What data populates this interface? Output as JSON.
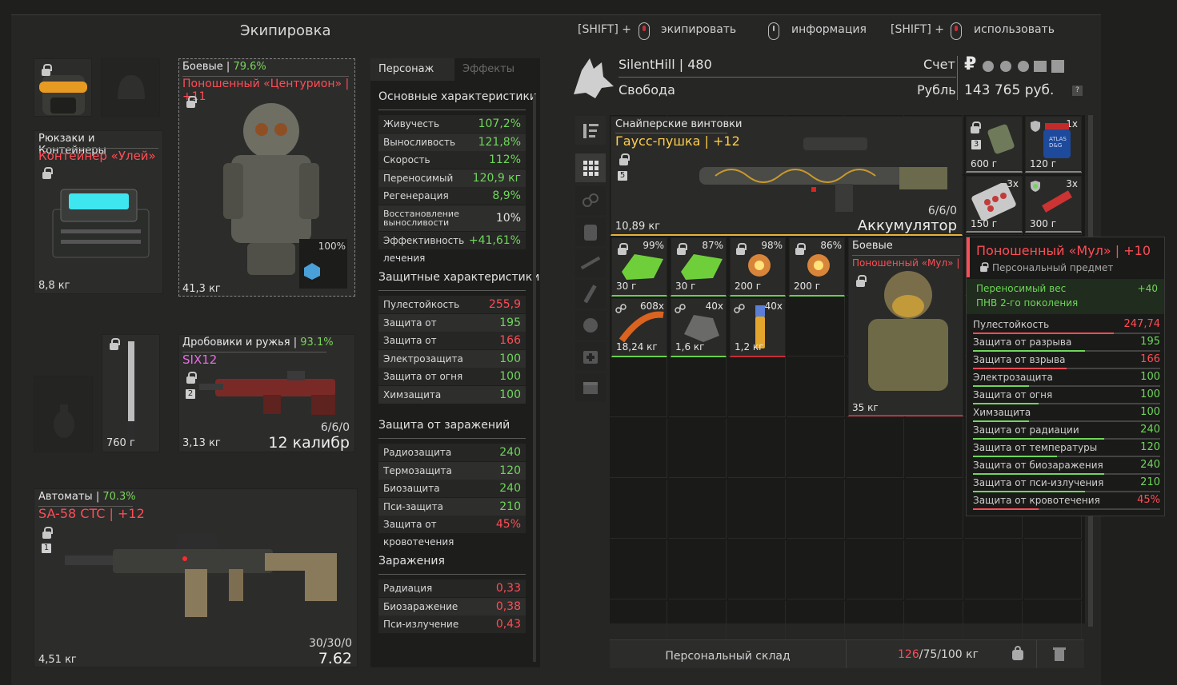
{
  "header": {
    "title": "Экипировка",
    "hint1_key": "[SHIFT] +",
    "hint1_label": "экипировать",
    "hint2_label": "информация",
    "hint3_key": "[SHIFT] +",
    "hint3_label": "использовать"
  },
  "equip": {
    "backpack": {
      "category": "Рюкзаки и Контейнеры",
      "name": "Контейнер «Улей»",
      "weight": "8,8 кг"
    },
    "armor": {
      "category": "Боевые",
      "sep": " | ",
      "percent": "79.6%",
      "name": "Поношенный «Центурион» | +11",
      "weight": "41,3 кг",
      "container_pct": "100%"
    },
    "melee": {
      "weight": "760 г"
    },
    "shotgun": {
      "category": "Дробовики и ружья",
      "sep": " | ",
      "percent": "93.1%",
      "name": "SIX12",
      "slot": "2",
      "ammo": "6/6/0",
      "caliber": "12 калибр",
      "weight": "3,13 кг"
    },
    "rifle": {
      "category": "Автоматы",
      "sep": " | ",
      "percent": "70.3%",
      "name": "SA-58 CTC | +12",
      "slot": "1",
      "ammo": "30/30/0",
      "caliber": "7.62",
      "weight": "4,51 кг"
    }
  },
  "stats": {
    "tabs": [
      "Персонаж",
      "Эффекты"
    ],
    "main_title": "Основные характеристики",
    "main": [
      {
        "label": "Живучесть",
        "value": "107,2%",
        "color": "#6fd65a"
      },
      {
        "label": "Выносливость",
        "value": "121,8%",
        "color": "#6fd65a"
      },
      {
        "label": "Скорость",
        "value": "112%",
        "color": "#6fd65a"
      },
      {
        "label": "Переносимый вес",
        "value": "120,9 кг",
        "color": "#6fd65a"
      },
      {
        "label": "Регенерация",
        "value": "8,9%",
        "color": "#6fd65a"
      },
      {
        "label": "Восстановление выносливости",
        "value": "10%",
        "color": "#e0e0e0"
      },
      {
        "label": "Эффективность лечения",
        "value": "+41,61%",
        "color": "#6fd65a"
      }
    ],
    "def_title": "Защитные характеристики",
    "def": [
      {
        "label": "Пулестойкость",
        "value": "255,9",
        "color": "#ff4d55"
      },
      {
        "label": "Защита от разрыва",
        "value": "195",
        "color": "#6fd65a"
      },
      {
        "label": "Защита от взрыва",
        "value": "166",
        "color": "#ff4d55"
      },
      {
        "label": "Электрозащита",
        "value": "100",
        "color": "#6fd65a"
      },
      {
        "label": "Защита от огня",
        "value": "100",
        "color": "#6fd65a"
      },
      {
        "label": "Химзащита",
        "value": "100",
        "color": "#6fd65a"
      }
    ],
    "inf_title": "Защита от заражений",
    "inf": [
      {
        "label": "Радиозащита",
        "value": "240",
        "color": "#6fd65a"
      },
      {
        "label": "Термозащита",
        "value": "120",
        "color": "#6fd65a"
      },
      {
        "label": "Биозащита",
        "value": "240",
        "color": "#6fd65a"
      },
      {
        "label": "Пси-защита",
        "value": "210",
        "color": "#6fd65a"
      },
      {
        "label": "Защита от кровотечения",
        "value": "45%",
        "color": "#ff4d55"
      }
    ],
    "cont_title": "Заражения",
    "cont": [
      {
        "label": "Радиация",
        "value": "0,33",
        "color": "#ff4d55"
      },
      {
        "label": "Биозаражение",
        "value": "0,38",
        "color": "#ff4d55"
      },
      {
        "label": "Пси-излучение",
        "value": "0,43",
        "color": "#ff4d55"
      }
    ]
  },
  "player": {
    "name": "SilentHill",
    "sep": " | ",
    "rank": "480",
    "faction": "Свобода",
    "account_label": "Счет",
    "currency_label": "Рубль",
    "money": "143 765 руб.",
    "currency_symbol": "₽",
    "help": "?"
  },
  "inventory": {
    "gauss": {
      "category": "Снайперские винтовки",
      "name": "Гаусс-пушка | +12",
      "slot": "5",
      "ammo": "6/6/0",
      "ammo_type": "Аккумулятор",
      "weight": "10,89 кг"
    },
    "small": [
      {
        "count": "",
        "weight": "600 г",
        "badge": "3"
      },
      {
        "count": "1x",
        "weight": "120 г",
        "jar": "ATLAS D&G"
      },
      {
        "count": "3x",
        "weight": "150 г"
      },
      {
        "count": "3x",
        "weight": "300 г"
      }
    ],
    "row1": [
      {
        "pct": "99%",
        "weight": "30 г"
      },
      {
        "pct": "87%",
        "weight": "30 г"
      },
      {
        "pct": "98%",
        "weight": "200 г"
      },
      {
        "pct": "86%",
        "weight": "200 г"
      }
    ],
    "row2": [
      {
        "count": "608x",
        "weight": "18,24 кг"
      },
      {
        "count": "40x",
        "weight": "1,6 кг"
      },
      {
        "count": "40x",
        "weight": "1,2 кг"
      }
    ],
    "armor": {
      "category": "Боевые",
      "name": "Поношенный «Мул» | +...",
      "weight": "35 кг"
    }
  },
  "tooltip": {
    "title": "Поношенный «Мул» | +10",
    "subtitle": "Персональный предмет",
    "bonus": [
      {
        "label": "Переносимый вес",
        "value": "+40"
      },
      {
        "label": "ПНВ 2-го поколения",
        "value": ""
      }
    ],
    "rows": [
      {
        "label": "Пулестойкость",
        "value": "247,74",
        "color": "#ff4d55",
        "fill": 0.75
      },
      {
        "label": "Защита от разрыва",
        "value": "195",
        "color": "#6fd65a",
        "fill": 0.6
      },
      {
        "label": "Защита от взрыва",
        "value": "166",
        "color": "#ff4d55",
        "fill": 0.5
      },
      {
        "label": "Электрозащита",
        "value": "100",
        "color": "#6fd65a",
        "fill": 0.3
      },
      {
        "label": "Защита от огня",
        "value": "100",
        "color": "#6fd65a",
        "fill": 0.35
      },
      {
        "label": "Химзащита",
        "value": "100",
        "color": "#6fd65a",
        "fill": 0.3
      },
      {
        "label": "Защита от радиации",
        "value": "240",
        "color": "#6fd65a",
        "fill": 0.7
      },
      {
        "label": "Защита от температуры",
        "value": "120",
        "color": "#6fd65a",
        "fill": 0.45
      },
      {
        "label": "Защита от биозаражения",
        "value": "240",
        "color": "#6fd65a",
        "fill": 0.7
      },
      {
        "label": "Защита от пси-излучения",
        "value": "210",
        "color": "#6fd65a",
        "fill": 0.6
      },
      {
        "label": "Защита от кровотечения",
        "value": "45%",
        "color": "#ff4d55",
        "fill": 0.35
      }
    ]
  },
  "storage": {
    "label": "Персональный склад",
    "weight_cur": "126",
    "weight_rest": "/75/100 кг"
  }
}
